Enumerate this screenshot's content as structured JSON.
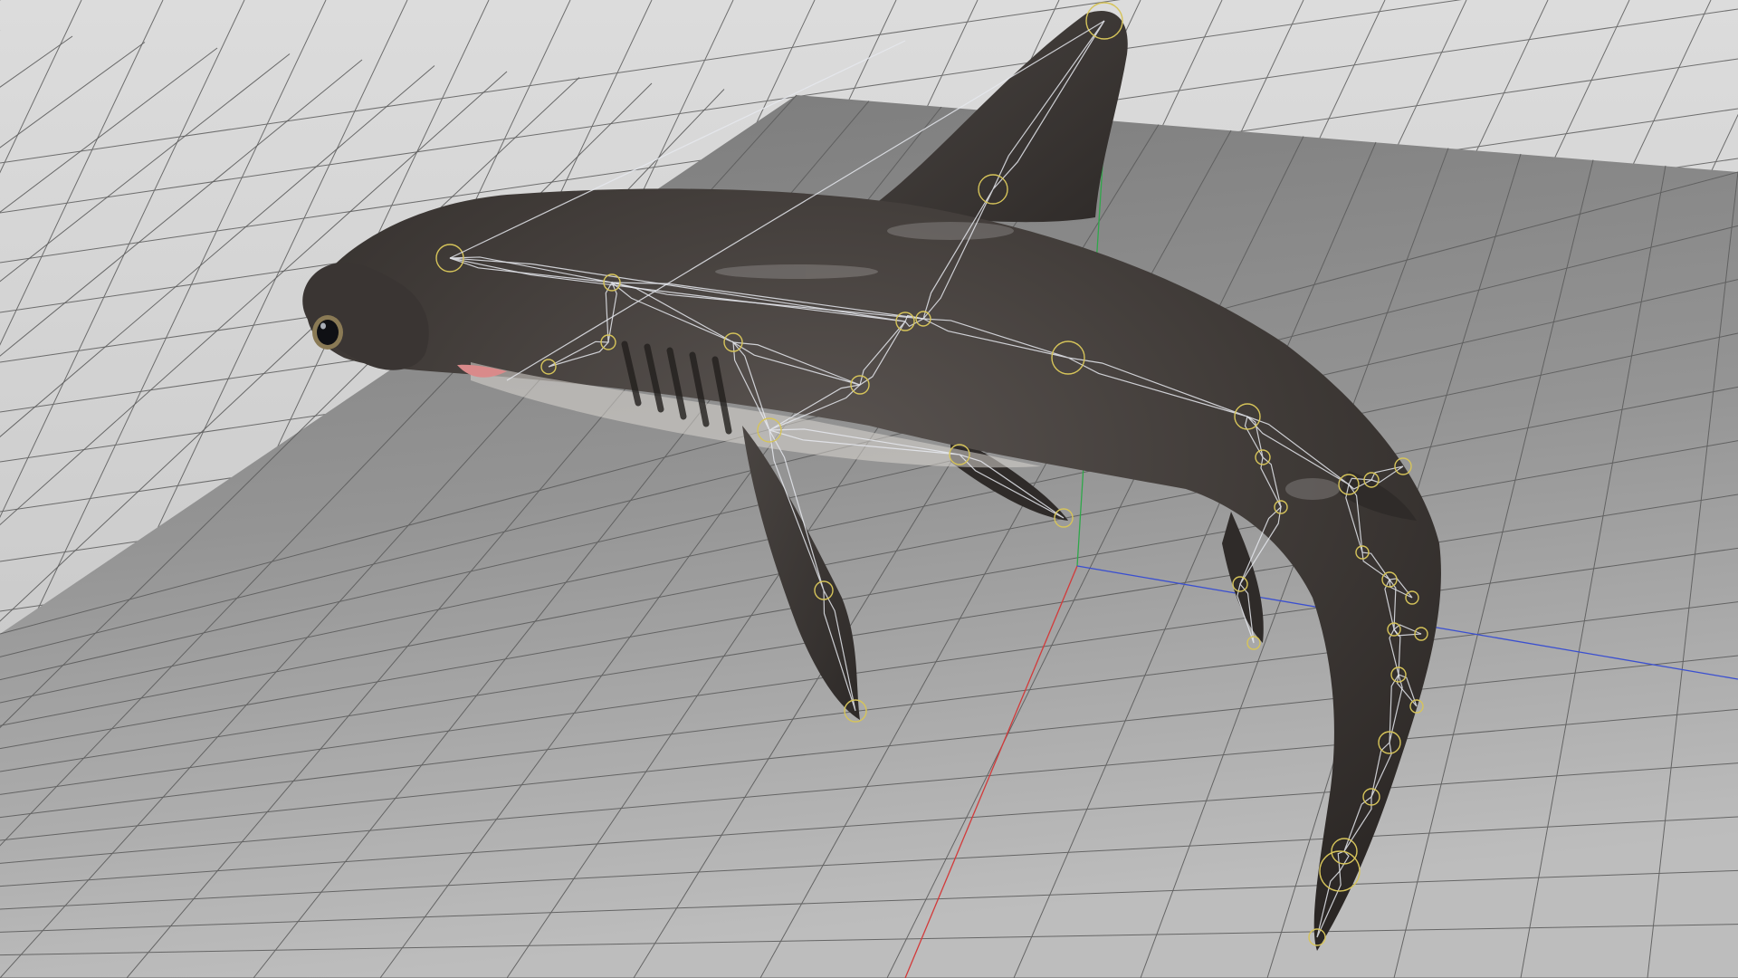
{
  "viewport": {
    "view_mode": "perspective",
    "grid_visible": true,
    "background_color": "#c9c9c9",
    "ground_plane_color": "#8f8f8f",
    "grid_line_color": "#555555",
    "axis_colors": {
      "x": "#d23a3a",
      "y": "#2fa84a",
      "z": "#3a4fd0"
    }
  },
  "model": {
    "name": "hammerhead-shark",
    "skin_color": "#3d3835",
    "belly_color": "#d9d6d0",
    "rig": {
      "visible": true,
      "bone_color": "#e6e9ee",
      "joint_color": "#d6c45a"
    }
  }
}
